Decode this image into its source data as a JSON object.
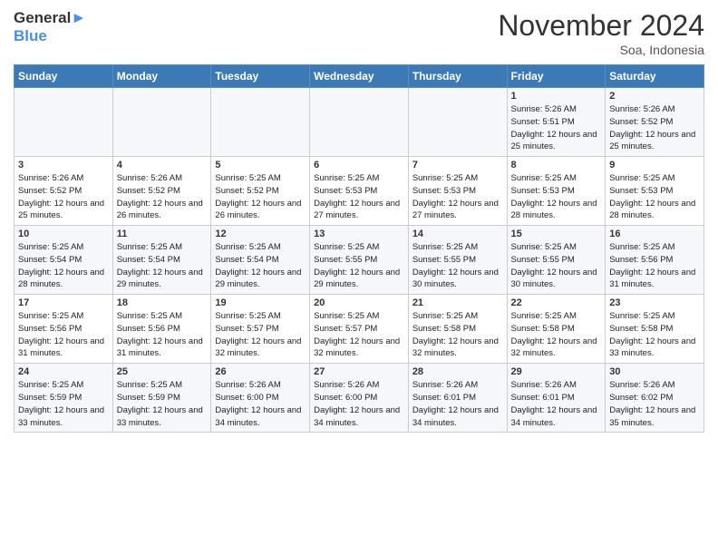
{
  "header": {
    "logo_line1": "General",
    "logo_line2": "Blue",
    "month_title": "November 2024",
    "subtitle": "Soa, Indonesia"
  },
  "weekdays": [
    "Sunday",
    "Monday",
    "Tuesday",
    "Wednesday",
    "Thursday",
    "Friday",
    "Saturday"
  ],
  "weeks": [
    [
      {
        "day": "",
        "info": ""
      },
      {
        "day": "",
        "info": ""
      },
      {
        "day": "",
        "info": ""
      },
      {
        "day": "",
        "info": ""
      },
      {
        "day": "",
        "info": ""
      },
      {
        "day": "1",
        "info": "Sunrise: 5:26 AM\nSunset: 5:51 PM\nDaylight: 12 hours and 25 minutes."
      },
      {
        "day": "2",
        "info": "Sunrise: 5:26 AM\nSunset: 5:52 PM\nDaylight: 12 hours and 25 minutes."
      }
    ],
    [
      {
        "day": "3",
        "info": "Sunrise: 5:26 AM\nSunset: 5:52 PM\nDaylight: 12 hours and 25 minutes."
      },
      {
        "day": "4",
        "info": "Sunrise: 5:26 AM\nSunset: 5:52 PM\nDaylight: 12 hours and 26 minutes."
      },
      {
        "day": "5",
        "info": "Sunrise: 5:25 AM\nSunset: 5:52 PM\nDaylight: 12 hours and 26 minutes."
      },
      {
        "day": "6",
        "info": "Sunrise: 5:25 AM\nSunset: 5:53 PM\nDaylight: 12 hours and 27 minutes."
      },
      {
        "day": "7",
        "info": "Sunrise: 5:25 AM\nSunset: 5:53 PM\nDaylight: 12 hours and 27 minutes."
      },
      {
        "day": "8",
        "info": "Sunrise: 5:25 AM\nSunset: 5:53 PM\nDaylight: 12 hours and 28 minutes."
      },
      {
        "day": "9",
        "info": "Sunrise: 5:25 AM\nSunset: 5:53 PM\nDaylight: 12 hours and 28 minutes."
      }
    ],
    [
      {
        "day": "10",
        "info": "Sunrise: 5:25 AM\nSunset: 5:54 PM\nDaylight: 12 hours and 28 minutes."
      },
      {
        "day": "11",
        "info": "Sunrise: 5:25 AM\nSunset: 5:54 PM\nDaylight: 12 hours and 29 minutes."
      },
      {
        "day": "12",
        "info": "Sunrise: 5:25 AM\nSunset: 5:54 PM\nDaylight: 12 hours and 29 minutes."
      },
      {
        "day": "13",
        "info": "Sunrise: 5:25 AM\nSunset: 5:55 PM\nDaylight: 12 hours and 29 minutes."
      },
      {
        "day": "14",
        "info": "Sunrise: 5:25 AM\nSunset: 5:55 PM\nDaylight: 12 hours and 30 minutes."
      },
      {
        "day": "15",
        "info": "Sunrise: 5:25 AM\nSunset: 5:55 PM\nDaylight: 12 hours and 30 minutes."
      },
      {
        "day": "16",
        "info": "Sunrise: 5:25 AM\nSunset: 5:56 PM\nDaylight: 12 hours and 31 minutes."
      }
    ],
    [
      {
        "day": "17",
        "info": "Sunrise: 5:25 AM\nSunset: 5:56 PM\nDaylight: 12 hours and 31 minutes."
      },
      {
        "day": "18",
        "info": "Sunrise: 5:25 AM\nSunset: 5:56 PM\nDaylight: 12 hours and 31 minutes."
      },
      {
        "day": "19",
        "info": "Sunrise: 5:25 AM\nSunset: 5:57 PM\nDaylight: 12 hours and 32 minutes."
      },
      {
        "day": "20",
        "info": "Sunrise: 5:25 AM\nSunset: 5:57 PM\nDaylight: 12 hours and 32 minutes."
      },
      {
        "day": "21",
        "info": "Sunrise: 5:25 AM\nSunset: 5:58 PM\nDaylight: 12 hours and 32 minutes."
      },
      {
        "day": "22",
        "info": "Sunrise: 5:25 AM\nSunset: 5:58 PM\nDaylight: 12 hours and 32 minutes."
      },
      {
        "day": "23",
        "info": "Sunrise: 5:25 AM\nSunset: 5:58 PM\nDaylight: 12 hours and 33 minutes."
      }
    ],
    [
      {
        "day": "24",
        "info": "Sunrise: 5:25 AM\nSunset: 5:59 PM\nDaylight: 12 hours and 33 minutes."
      },
      {
        "day": "25",
        "info": "Sunrise: 5:25 AM\nSunset: 5:59 PM\nDaylight: 12 hours and 33 minutes."
      },
      {
        "day": "26",
        "info": "Sunrise: 5:26 AM\nSunset: 6:00 PM\nDaylight: 12 hours and 34 minutes."
      },
      {
        "day": "27",
        "info": "Sunrise: 5:26 AM\nSunset: 6:00 PM\nDaylight: 12 hours and 34 minutes."
      },
      {
        "day": "28",
        "info": "Sunrise: 5:26 AM\nSunset: 6:01 PM\nDaylight: 12 hours and 34 minutes."
      },
      {
        "day": "29",
        "info": "Sunrise: 5:26 AM\nSunset: 6:01 PM\nDaylight: 12 hours and 34 minutes."
      },
      {
        "day": "30",
        "info": "Sunrise: 5:26 AM\nSunset: 6:02 PM\nDaylight: 12 hours and 35 minutes."
      }
    ]
  ]
}
